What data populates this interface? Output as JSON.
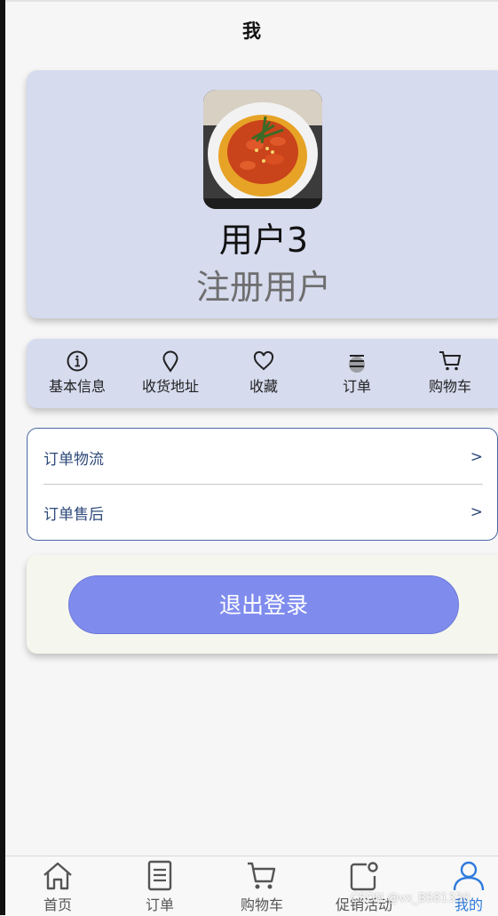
{
  "header": {
    "title": "我"
  },
  "profile": {
    "username": "用户3",
    "role": "注册用户"
  },
  "quick_menu": [
    {
      "label": "基本信息",
      "icon": "info-icon"
    },
    {
      "label": "收货地址",
      "icon": "location-pin-icon"
    },
    {
      "label": "收藏",
      "icon": "heart-icon"
    },
    {
      "label": "订单",
      "icon": "list-icon"
    },
    {
      "label": "购物车",
      "icon": "cart-icon"
    }
  ],
  "order_links": [
    {
      "label": "订单物流",
      "arrow": ">"
    },
    {
      "label": "订单售后",
      "arrow": ">"
    }
  ],
  "logout": {
    "label": "退出登录"
  },
  "tabbar": [
    {
      "label": "首页",
      "icon": "home-icon"
    },
    {
      "label": "订单",
      "icon": "document-icon"
    },
    {
      "label": "购物车",
      "icon": "cart-icon"
    },
    {
      "label": "促销活动",
      "icon": "promotion-icon"
    },
    {
      "label": "我的",
      "icon": "user-icon",
      "active": true
    }
  ],
  "watermark": "CSDN @vx_BS81330",
  "colors": {
    "card_bg": "#d6dbee",
    "logout_button": "#7f8cee",
    "active_tab": "#2f7bdc",
    "link_text": "#2e4a7a"
  }
}
